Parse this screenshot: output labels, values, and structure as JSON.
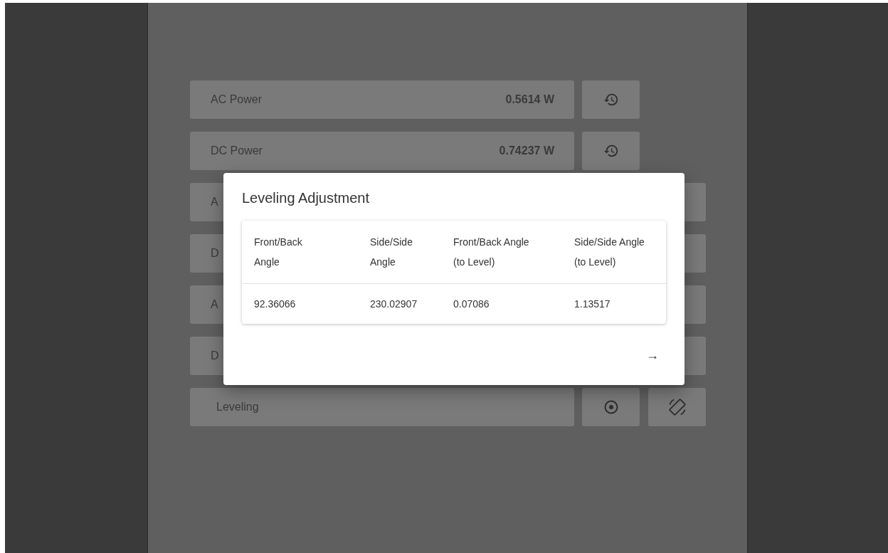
{
  "rows": [
    {
      "label": "AC Power",
      "value": "0.5614 W",
      "buttons": [
        {
          "kind": "history"
        }
      ]
    },
    {
      "label": "DC Power",
      "value": "0.74237 W",
      "buttons": [
        {
          "kind": "history"
        }
      ]
    },
    {
      "label": "A",
      "buttons": [
        {
          "kind": "blank"
        }
      ]
    },
    {
      "label": "D",
      "buttons": [
        {
          "kind": "blank"
        }
      ]
    },
    {
      "label": "A",
      "buttons": [
        {
          "kind": "blank"
        }
      ]
    },
    {
      "label": "D",
      "buttons": [
        {
          "kind": "blank"
        }
      ]
    },
    {
      "label": "Leveling",
      "buttons": [
        {
          "kind": "target"
        },
        {
          "kind": "rotate"
        }
      ]
    }
  ],
  "dialog": {
    "title": "Leveling Adjustment",
    "columns": [
      "Front/Back Angle",
      "Side/Side Angle",
      "Front/Back Angle (to Level)",
      "Side/Side Angle (to Level)"
    ],
    "rows": [
      [
        "92.36066",
        "230.02907",
        "0.07086",
        "1.13517"
      ]
    ],
    "action": "→"
  }
}
